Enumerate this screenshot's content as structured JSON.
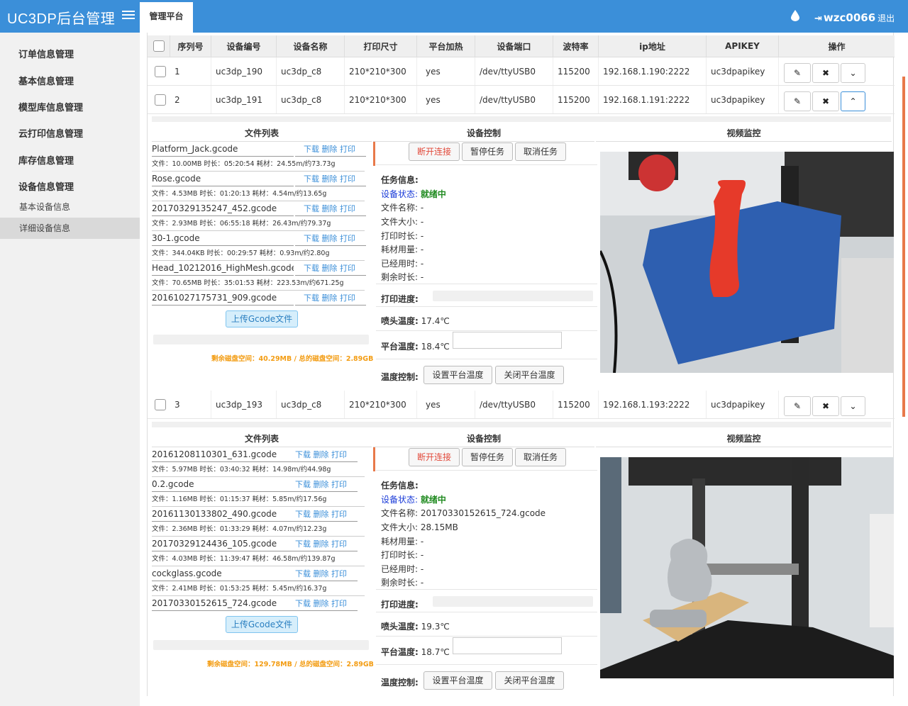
{
  "header": {
    "brand": "UC3DP后台管理",
    "tab": "管理平台",
    "user": "wzc0066",
    "logout": "退出"
  },
  "sidebar": {
    "items": [
      "订单信息管理",
      "基本信息管理",
      "模型库信息管理",
      "云打印信息管理",
      "库存信息管理",
      "设备信息管理"
    ],
    "subitems": [
      "基本设备信息",
      "详细设备信息"
    ]
  },
  "table": {
    "headers": [
      "序列号",
      "设备编号",
      "设备名称",
      "打印尺寸",
      "平台加热",
      "设备端口",
      "波特率",
      "ip地址",
      "APIKEY",
      "操作"
    ],
    "rows": [
      [
        "1",
        "uc3dp_190",
        "uc3dp_c8",
        "210*210*300",
        "yes",
        "/dev/ttyUSB0",
        "115200",
        "192.168.1.190:2222",
        "uc3dpapikey"
      ],
      [
        "2",
        "uc3dp_191",
        "uc3dp_c8",
        "210*210*300",
        "yes",
        "/dev/ttyUSB0",
        "115200",
        "192.168.1.191:2222",
        "uc3dpapikey"
      ],
      [
        "3",
        "uc3dp_193",
        "uc3dp_c8",
        "210*210*300",
        "yes",
        "/dev/ttyUSB0",
        "115200",
        "192.168.1.193:2222",
        "uc3dpapikey"
      ]
    ]
  },
  "labels": {
    "files_title": "文件列表",
    "ctrl_title": "设备控制",
    "video_title": "视频监控",
    "actions": "下载 删除 打印",
    "upload": "上传Gcode文件",
    "btn_disconnect": "断开连接",
    "btn_pause": "暂停任务",
    "btn_cancel": "取消任务",
    "task_info": "任务信息:",
    "status": "设备状态:",
    "status_val": "就绪中",
    "progress": "打印进度:",
    "nozzle": "喷头温度:",
    "bed": "平台温度:",
    "temp_ctrl": "温度控制:",
    "set_bed": "设置平台温度",
    "close_bed": "关闭平台温度"
  },
  "panels": [
    {
      "files": [
        {
          "name": "Platform_Jack.gcode",
          "info": "文件：10.00MB 时长：05:20:54 耗材：24.55m/约73.73g"
        },
        {
          "name": "Rose.gcode",
          "info": "文件：4.53MB 时长：01:20:13 耗材：4.54m/约13.65g"
        },
        {
          "name": "20170329135247_452.gcode",
          "info": "文件：2.93MB 时长：06:55:18 耗材：26.43m/约79.37g"
        },
        {
          "name": "30-1.gcode",
          "info": "文件：344.04KB 时长：00:29:57 耗材：0.93m/约2.80g"
        },
        {
          "name": "Head_10212016_HighMesh.gcode",
          "info": "文件：70.65MB 时长：35:01:53 耗材：223.53m/约671.25g"
        },
        {
          "name": "20161027175731_909.gcode",
          "info": ""
        }
      ],
      "disk": "剩余磁盘空间：40.29MB / 总的磁盘空间：2.89GB",
      "info": [
        {
          "k": "文件名称:",
          "v": "-"
        },
        {
          "k": "文件大小:",
          "v": "-"
        },
        {
          "k": "打印时长:",
          "v": "-"
        },
        {
          "k": "耗材用量:",
          "v": "-"
        },
        {
          "k": "已经用时:",
          "v": "-"
        },
        {
          "k": "剩余时长:",
          "v": "-"
        }
      ],
      "nozzle": "17.4℃",
      "bed": "18.4℃"
    },
    {
      "files": [
        {
          "name": "20161208110301_631.gcode",
          "info": "文件：5.97MB 时长：03:40:32 耗材：14.98m/约44.98g"
        },
        {
          "name": "0.2.gcode",
          "info": "文件：1.16MB 时长：01:15:37 耗材：5.85m/约17.56g"
        },
        {
          "name": "20161130133802_490.gcode",
          "info": "文件：2.36MB 时长：01:33:29 耗材：4.07m/约12.23g"
        },
        {
          "name": "20170329124436_105.gcode",
          "info": "文件：4.03MB 时长：11:39:47 耗材：46.58m/约139.87g"
        },
        {
          "name": "cockglass.gcode",
          "info": "文件：2.41MB 时长：01:53:25 耗材：5.45m/约16.37g"
        },
        {
          "name": "20170330152615_724.gcode",
          "info": ""
        }
      ],
      "disk": "剩余磁盘空间：129.78MB / 总的磁盘空间：2.89GB",
      "info": [
        {
          "k": "文件名称:",
          "v": "20170330152615_724.gcode"
        },
        {
          "k": "文件大小:",
          "v": "28.15MB"
        },
        {
          "k": "耗材用量:",
          "v": "-"
        },
        {
          "k": "打印时长:",
          "v": "-"
        },
        {
          "k": "已经用时:",
          "v": "-"
        },
        {
          "k": "剩余时长:",
          "v": "-"
        }
      ],
      "nozzle": "19.3℃",
      "bed": "18.7℃"
    }
  ],
  "colors": {
    "accent": "#3b8fd9",
    "danger": "#e24a3b",
    "ok": "#1f8a1f",
    "warn": "#f39c12"
  }
}
